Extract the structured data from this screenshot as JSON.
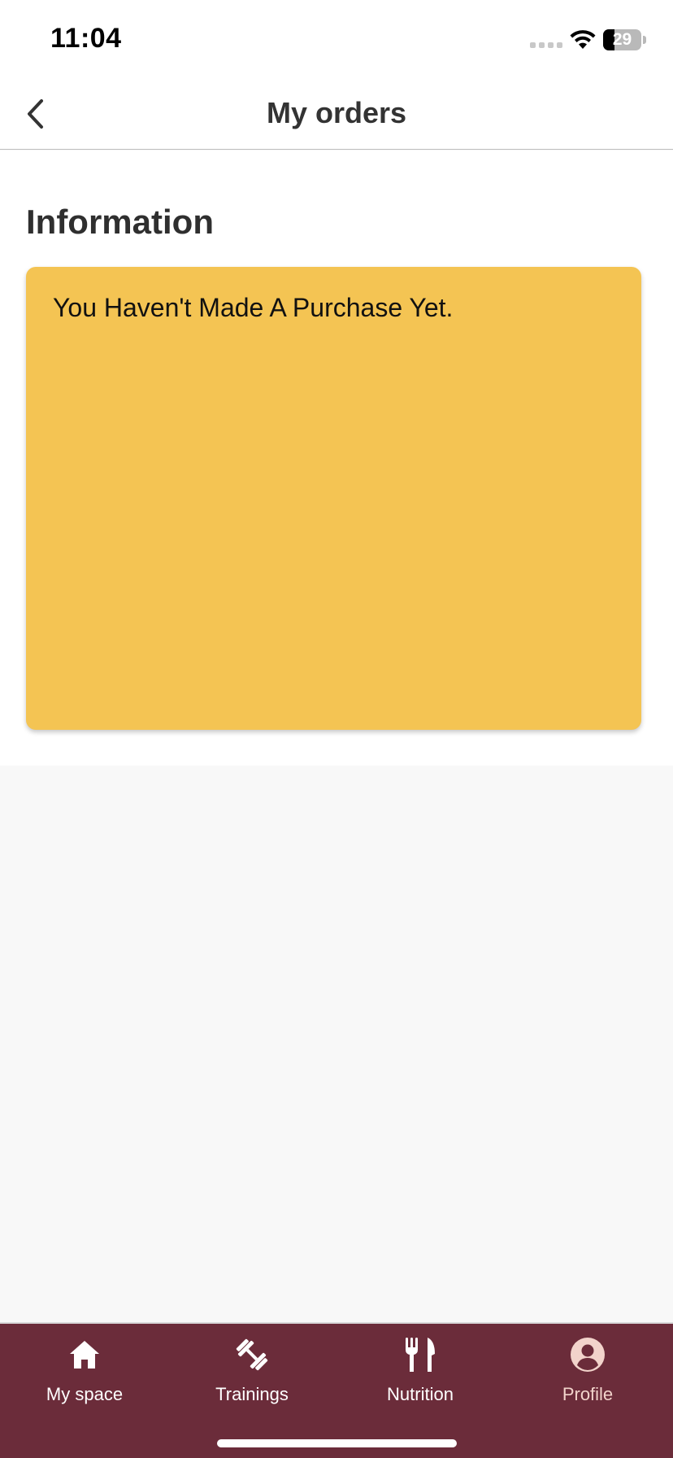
{
  "status_bar": {
    "time": "11:04",
    "battery_level": "29",
    "battery_fraction": 0.29
  },
  "header": {
    "title": "My orders",
    "back_icon": "chevron-left-icon"
  },
  "content": {
    "section_title": "Information",
    "message": "You Haven't Made A Purchase Yet.",
    "card_color": "#f4c453"
  },
  "bottom_nav": {
    "background": "#6b2c3a",
    "items": [
      {
        "label": "My space",
        "icon": "home-icon",
        "active": false
      },
      {
        "label": "Trainings",
        "icon": "dumbbell-icon",
        "active": false
      },
      {
        "label": "Nutrition",
        "icon": "fork-knife-icon",
        "active": false
      },
      {
        "label": "Profile",
        "icon": "profile-icon",
        "active": true
      }
    ],
    "active_color": "#f2d3cb"
  }
}
